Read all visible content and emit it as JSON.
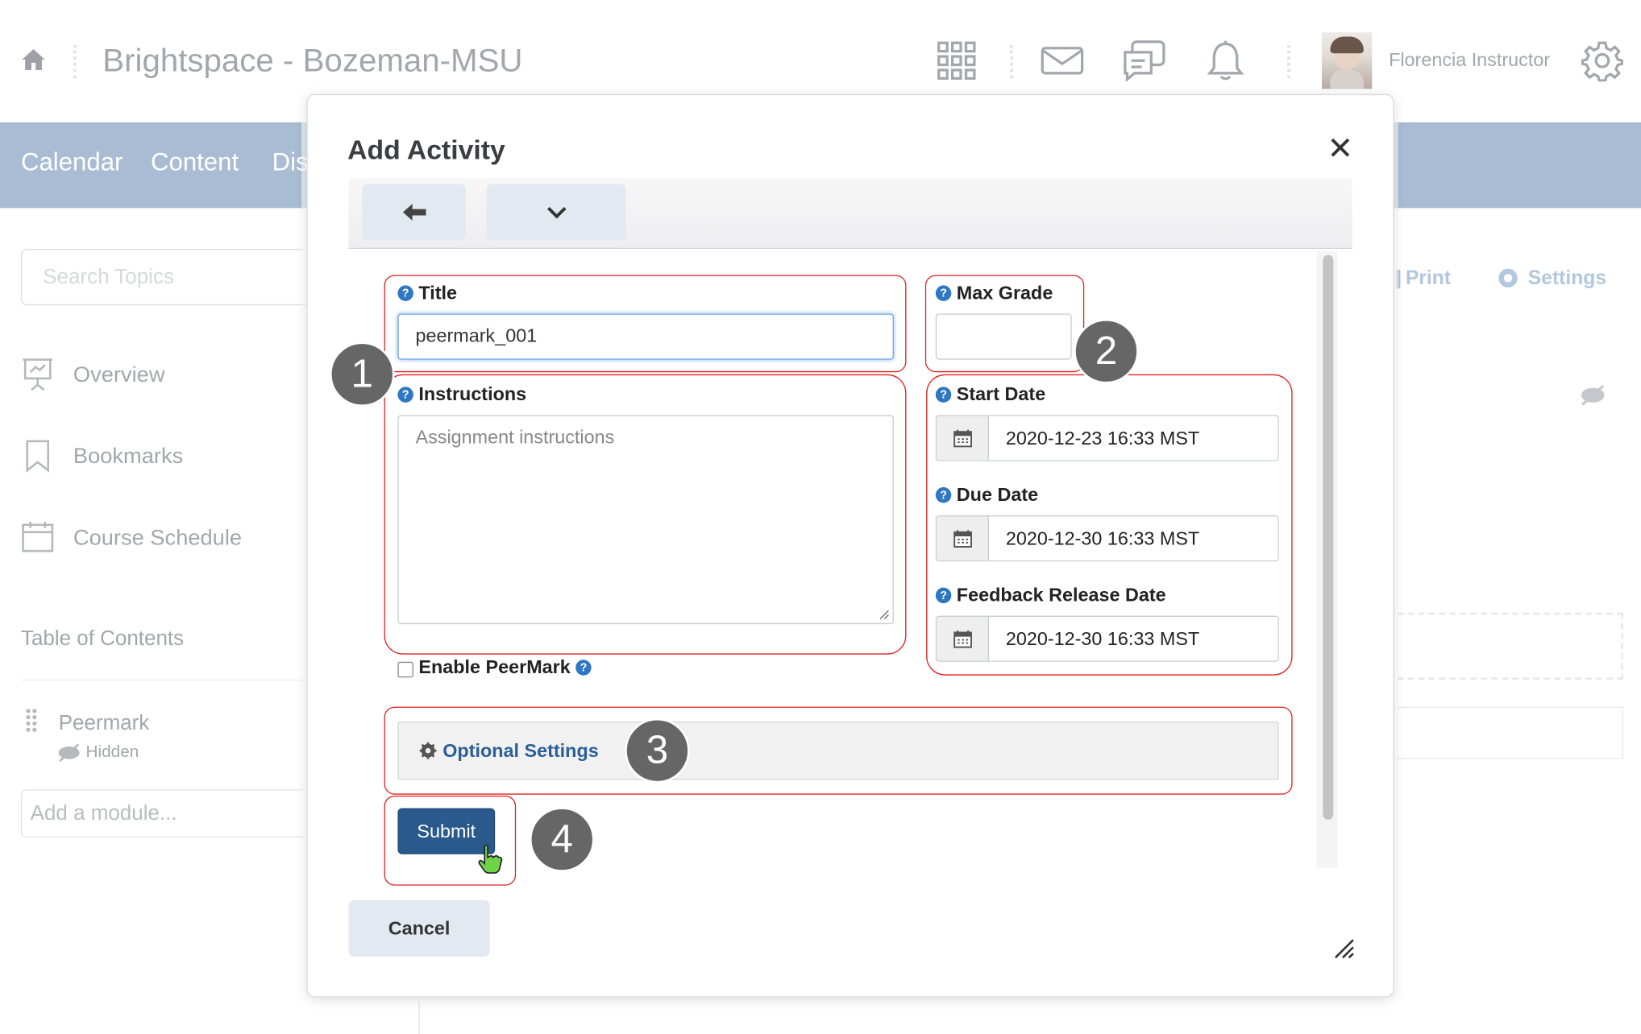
{
  "header": {
    "brand": "Brightspace - Bozeman-MSU",
    "user_name": "Florencia Instructor",
    "icons": [
      "home-icon",
      "apps-grid-icon",
      "mail-icon",
      "chat-icon",
      "bell-icon",
      "gear-icon"
    ]
  },
  "nav": {
    "items": [
      "Calendar",
      "Content",
      "Dis"
    ]
  },
  "sidebar": {
    "search_placeholder": "Search Topics",
    "items": [
      {
        "label": "Overview",
        "icon": "presentation-icon"
      },
      {
        "label": "Bookmarks",
        "icon": "bookmark-icon"
      },
      {
        "label": "Course Schedule",
        "icon": "calendar-icon"
      }
    ],
    "toc_heading": "Table of Contents",
    "module": {
      "name": "Peermark",
      "status": "Hidden"
    },
    "add_module_placeholder": "Add a module..."
  },
  "content_toolbar": {
    "print": "Print",
    "settings": "Settings"
  },
  "modal": {
    "title": "Add Activity",
    "fields": {
      "title_label": "Title",
      "title_value": "peermark_001",
      "max_grade_label": "Max Grade",
      "max_grade_value": "",
      "instructions_label": "Instructions",
      "instructions_placeholder": "Assignment instructions",
      "start_date_label": "Start Date",
      "start_date_value": "2020-12-23 16:33 MST",
      "due_date_label": "Due Date",
      "due_date_value": "2020-12-30 16:33 MST",
      "feedback_date_label": "Feedback Release Date",
      "feedback_date_value": "2020-12-30 16:33 MST",
      "enable_peermark_label": "Enable PeerMark",
      "enable_peermark_checked": false
    },
    "optional_settings_label": "Optional Settings",
    "submit_label": "Submit",
    "cancel_label": "Cancel"
  },
  "callouts": [
    "1",
    "2",
    "3",
    "4"
  ],
  "colors": {
    "accent": "#2a5a8c",
    "nav": "#a9bcd3",
    "annotation": "#e02020",
    "help": "#2e77c3"
  }
}
